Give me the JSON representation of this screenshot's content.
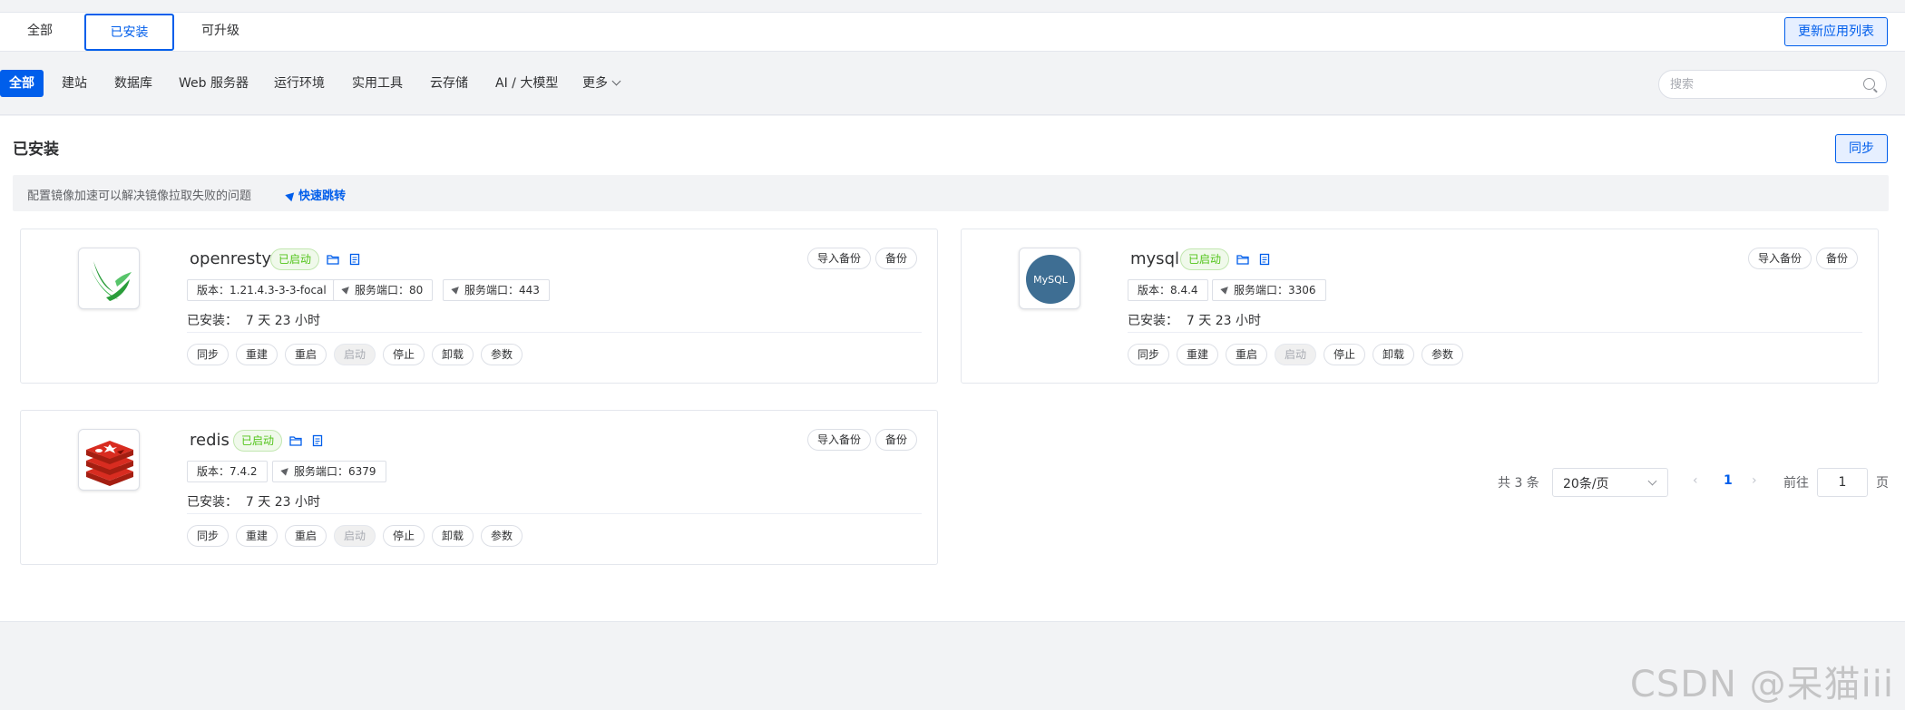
{
  "top_tabs": {
    "all": "全部",
    "installed": "已安装",
    "upgradable": "可升级"
  },
  "update_button": "更新应用列表",
  "categories": [
    "全部",
    "建站",
    "数据库",
    "Web 服务器",
    "运行环境",
    "实用工具",
    "云存储",
    "AI / 大模型",
    "更多"
  ],
  "search": {
    "placeholder": "搜索"
  },
  "main": {
    "title": "已安装",
    "sync_button": "同步",
    "notice_text": "配置镜像加速可以解决镜像拉取失败的问题",
    "notice_link": "快速跳转"
  },
  "apps": [
    {
      "name": "openresty",
      "status": "已启动",
      "tags": [
        "版本：1.21.4.3-3-3-focal",
        "服务端口：80",
        "服务端口：443"
      ],
      "installed_label": "已安装：",
      "installed_value": "7 天 23 小时",
      "backup_buttons": [
        "导入备份",
        "备份"
      ],
      "actions": [
        "同步",
        "重建",
        "重启",
        "启动",
        "停止",
        "卸载",
        "参数"
      ]
    },
    {
      "name": "mysql",
      "status": "已启动",
      "tags": [
        "版本：8.4.4",
        "服务端口：3306"
      ],
      "installed_label": "已安装：",
      "installed_value": "7 天 23 小时",
      "backup_buttons": [
        "导入备份",
        "备份"
      ],
      "actions": [
        "同步",
        "重建",
        "重启",
        "启动",
        "停止",
        "卸载",
        "参数"
      ],
      "logo_text": "MySQL"
    },
    {
      "name": "redis",
      "status": "已启动",
      "tags": [
        "版本：7.4.2",
        "服务端口：6379"
      ],
      "installed_label": "已安装：",
      "installed_value": "7 天 23 小时",
      "backup_buttons": [
        "导入备份",
        "备份"
      ],
      "actions": [
        "同步",
        "重建",
        "重启",
        "启动",
        "停止",
        "卸载",
        "参数"
      ]
    }
  ],
  "pagination": {
    "total": "共 3 条",
    "page_size": "20条/页",
    "prev": "‹",
    "current": "1",
    "next": "›",
    "goto_label": "前往",
    "goto_value": "1",
    "page_suffix": "页"
  },
  "watermark": "CSDN @呆猫iii",
  "colors": {
    "accent": "#005eeb",
    "status_green": "#52c41a",
    "redis_red": "#d82c20",
    "mysql_blue": "#4479a1"
  }
}
